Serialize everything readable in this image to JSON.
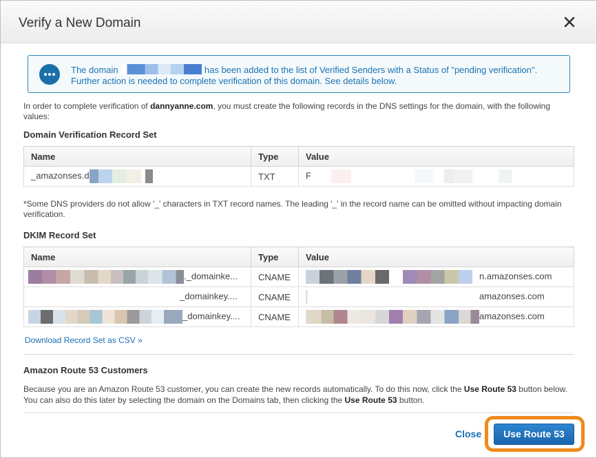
{
  "dialog": {
    "title": "Verify a New Domain",
    "close_icon": "close-x-icon"
  },
  "info": {
    "icon": "speech-bubble-icon",
    "text_before": "The domain ",
    "text_after": " has been added to the list of Verified Senders with a Status of \"pending verification\". Further action is needed to complete verification of this domain. See details below."
  },
  "intro": {
    "before": "In order to complete verification of ",
    "domain": "dannyanne.com",
    "after": ", you must create the following records in the DNS settings for the domain, with the following values:"
  },
  "verification": {
    "title": "Domain Verification Record Set",
    "columns": [
      "Name",
      "Type",
      "Value"
    ],
    "rows": [
      {
        "name": "_amazonses.d",
        "type": "TXT",
        "value": "F"
      }
    ]
  },
  "note": "*Some DNS providers do not allow '_' characters in TXT record names. The leading '_' in the record name can be omitted without impacting domain verification.",
  "dkim": {
    "title": "DKIM Record Set",
    "columns": [
      "Name",
      "Type",
      "Value"
    ],
    "rows": [
      {
        "name": "._domainke...",
        "type": "CNAME",
        "value": "n.amazonses.com"
      },
      {
        "name": "_domainkey....",
        "type": "CNAME",
        "value": "amazonses.com"
      },
      {
        "name": "_domainkey....",
        "type": "CNAME",
        "value": "amazonses.com"
      }
    ]
  },
  "download_link": "Download Record Set as CSV »",
  "route53": {
    "title": "Amazon Route 53 Customers",
    "p1": "Because you are an Amazon Route 53 customer, you can create the new records automatically. To do this now, click the ",
    "b1": "Use Route 53",
    "p2": " button below. You can also do this later by selecting the domain on the Domains tab, then clicking the ",
    "b2": "Use Route 53",
    "p3": " button."
  },
  "footer": {
    "close_label": "Close",
    "use_label": "Use Route 53"
  },
  "colors": {
    "accent": "#1a6fb5",
    "highlight": "#f08a1c",
    "info_border": "#2b87b5"
  }
}
